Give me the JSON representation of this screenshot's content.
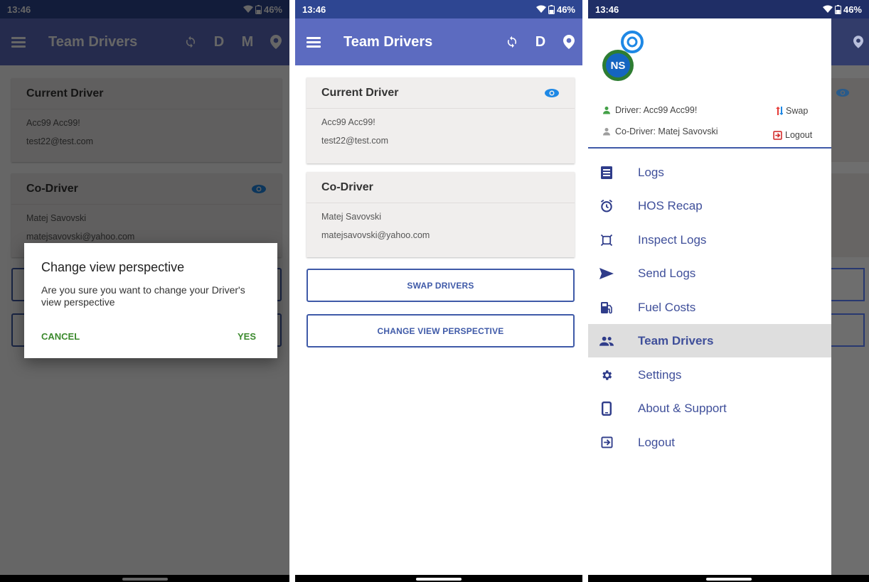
{
  "colors": {
    "appbar": "#5c6bc0",
    "statusbar": "#2e4692",
    "accent": "#3f5aa8",
    "dialog_button": "#3c8a2e"
  },
  "status": {
    "time": "13:46",
    "battery": "46%"
  },
  "appbar": {
    "title": "Team Drivers",
    "actions": {
      "d": "D",
      "m": "M"
    }
  },
  "current_driver": {
    "title": "Current Driver",
    "name": "Acc99 Acc99!",
    "email": "test22@test.com"
  },
  "co_driver": {
    "title": "Co-Driver",
    "name": "Matej Savovski",
    "email": "matejsavovski@yahoo.com"
  },
  "buttons": {
    "swap": "SWAP DRIVERS",
    "change": "CHANGE VIEW PERSPECTIVE"
  },
  "dialog": {
    "title": "Change view perspective",
    "message": "Are you sure you want to change your Driver's view perspective",
    "cancel": "CANCEL",
    "yes": "YES"
  },
  "drawer": {
    "driver": "Driver: Acc99 Acc99!",
    "co_driver": "Co-Driver: Matej Savovski",
    "swap": "Swap",
    "logout": "Logout",
    "items": [
      {
        "label": "Logs",
        "icon": "logs-icon"
      },
      {
        "label": "HOS Recap",
        "icon": "alarm-clock-icon"
      },
      {
        "label": "Inspect Logs",
        "icon": "inspect-icon"
      },
      {
        "label": "Send Logs",
        "icon": "send-icon"
      },
      {
        "label": "Fuel Costs",
        "icon": "fuel-icon"
      },
      {
        "label": "Team Drivers",
        "icon": "people-icon",
        "active": true
      },
      {
        "label": "Settings",
        "icon": "gear-icon"
      },
      {
        "label": "About & Support",
        "icon": "phone-icon"
      },
      {
        "label": "Logout",
        "icon": "logout-icon"
      }
    ]
  }
}
